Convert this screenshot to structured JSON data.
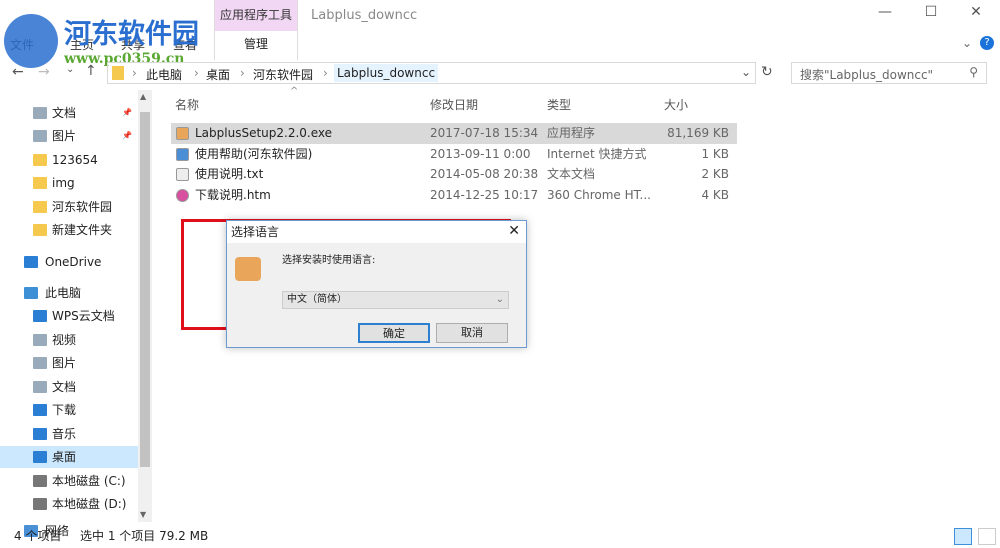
{
  "window": {
    "title": "Labplus_downcc",
    "context_tab": "应用程序工具",
    "context_subtab": "管理",
    "minimize": "—",
    "maximize": "☐",
    "close": "✕",
    "help": "?"
  },
  "ribbon": {
    "tabs": [
      "文件",
      "主页",
      "共享",
      "查看"
    ]
  },
  "watermark": {
    "name": "河东软件园",
    "url": "www.pc0359.cn"
  },
  "address": {
    "crumbs": [
      "此电脑",
      "桌面",
      "河东软件园",
      "Labplus_downcc"
    ],
    "search_placeholder": "搜索\"Labplus_downcc\""
  },
  "sidebar": {
    "items": [
      {
        "label": "文档",
        "icon": "documents-icon",
        "pinned": true
      },
      {
        "label": "图片",
        "icon": "pictures-icon",
        "pinned": true
      },
      {
        "label": "123654",
        "icon": "folder-icon"
      },
      {
        "label": "img",
        "icon": "folder-icon"
      },
      {
        "label": "河东软件园",
        "icon": "folder-icon"
      },
      {
        "label": "新建文件夹",
        "icon": "folder-icon"
      },
      {
        "label": "OneDrive",
        "icon": "cloud-icon"
      },
      {
        "label": "此电脑",
        "icon": "computer-icon"
      },
      {
        "label": "WPS云文档",
        "icon": "cloud-icon"
      },
      {
        "label": "视频",
        "icon": "videos-icon"
      },
      {
        "label": "图片",
        "icon": "pictures-icon"
      },
      {
        "label": "文档",
        "icon": "documents-icon"
      },
      {
        "label": "下载",
        "icon": "download-icon"
      },
      {
        "label": "音乐",
        "icon": "music-icon"
      },
      {
        "label": "桌面",
        "icon": "desktop-icon",
        "selected": true
      },
      {
        "label": "本地磁盘 (C:)",
        "icon": "drive-icon"
      },
      {
        "label": "本地磁盘 (D:)",
        "icon": "drive-icon"
      },
      {
        "label": "网络",
        "icon": "network-icon"
      }
    ]
  },
  "columns": {
    "name": "名称",
    "date": "修改日期",
    "type": "类型",
    "size": "大小"
  },
  "files": [
    {
      "name": "LabplusSetup2.2.0.exe",
      "date": "2017-07-18 15:34",
      "type": "应用程序",
      "size": "81,169 KB",
      "selected": true
    },
    {
      "name": "使用帮助(河东软件园)",
      "date": "2013-09-11 0:00",
      "type": "Internet 快捷方式",
      "size": "1 KB"
    },
    {
      "name": "使用说明.txt",
      "date": "2014-05-08 20:38",
      "type": "文本文档",
      "size": "2 KB"
    },
    {
      "name": "下载说明.htm",
      "date": "2014-12-25 10:17",
      "type": "360 Chrome HT...",
      "size": "4 KB"
    }
  ],
  "status": {
    "count": "4 个项目",
    "selection": "选中 1 个项目  79.2 MB"
  },
  "dialog": {
    "title": "选择语言",
    "prompt": "选择安装时使用语言:",
    "selected_language": "中文（简体）",
    "ok": "确定",
    "cancel": "取消",
    "close": "✕"
  },
  "colors": {
    "highlight": "#e0101b",
    "selection": "#cce8ff",
    "context_tab": "#f2d7f4"
  }
}
